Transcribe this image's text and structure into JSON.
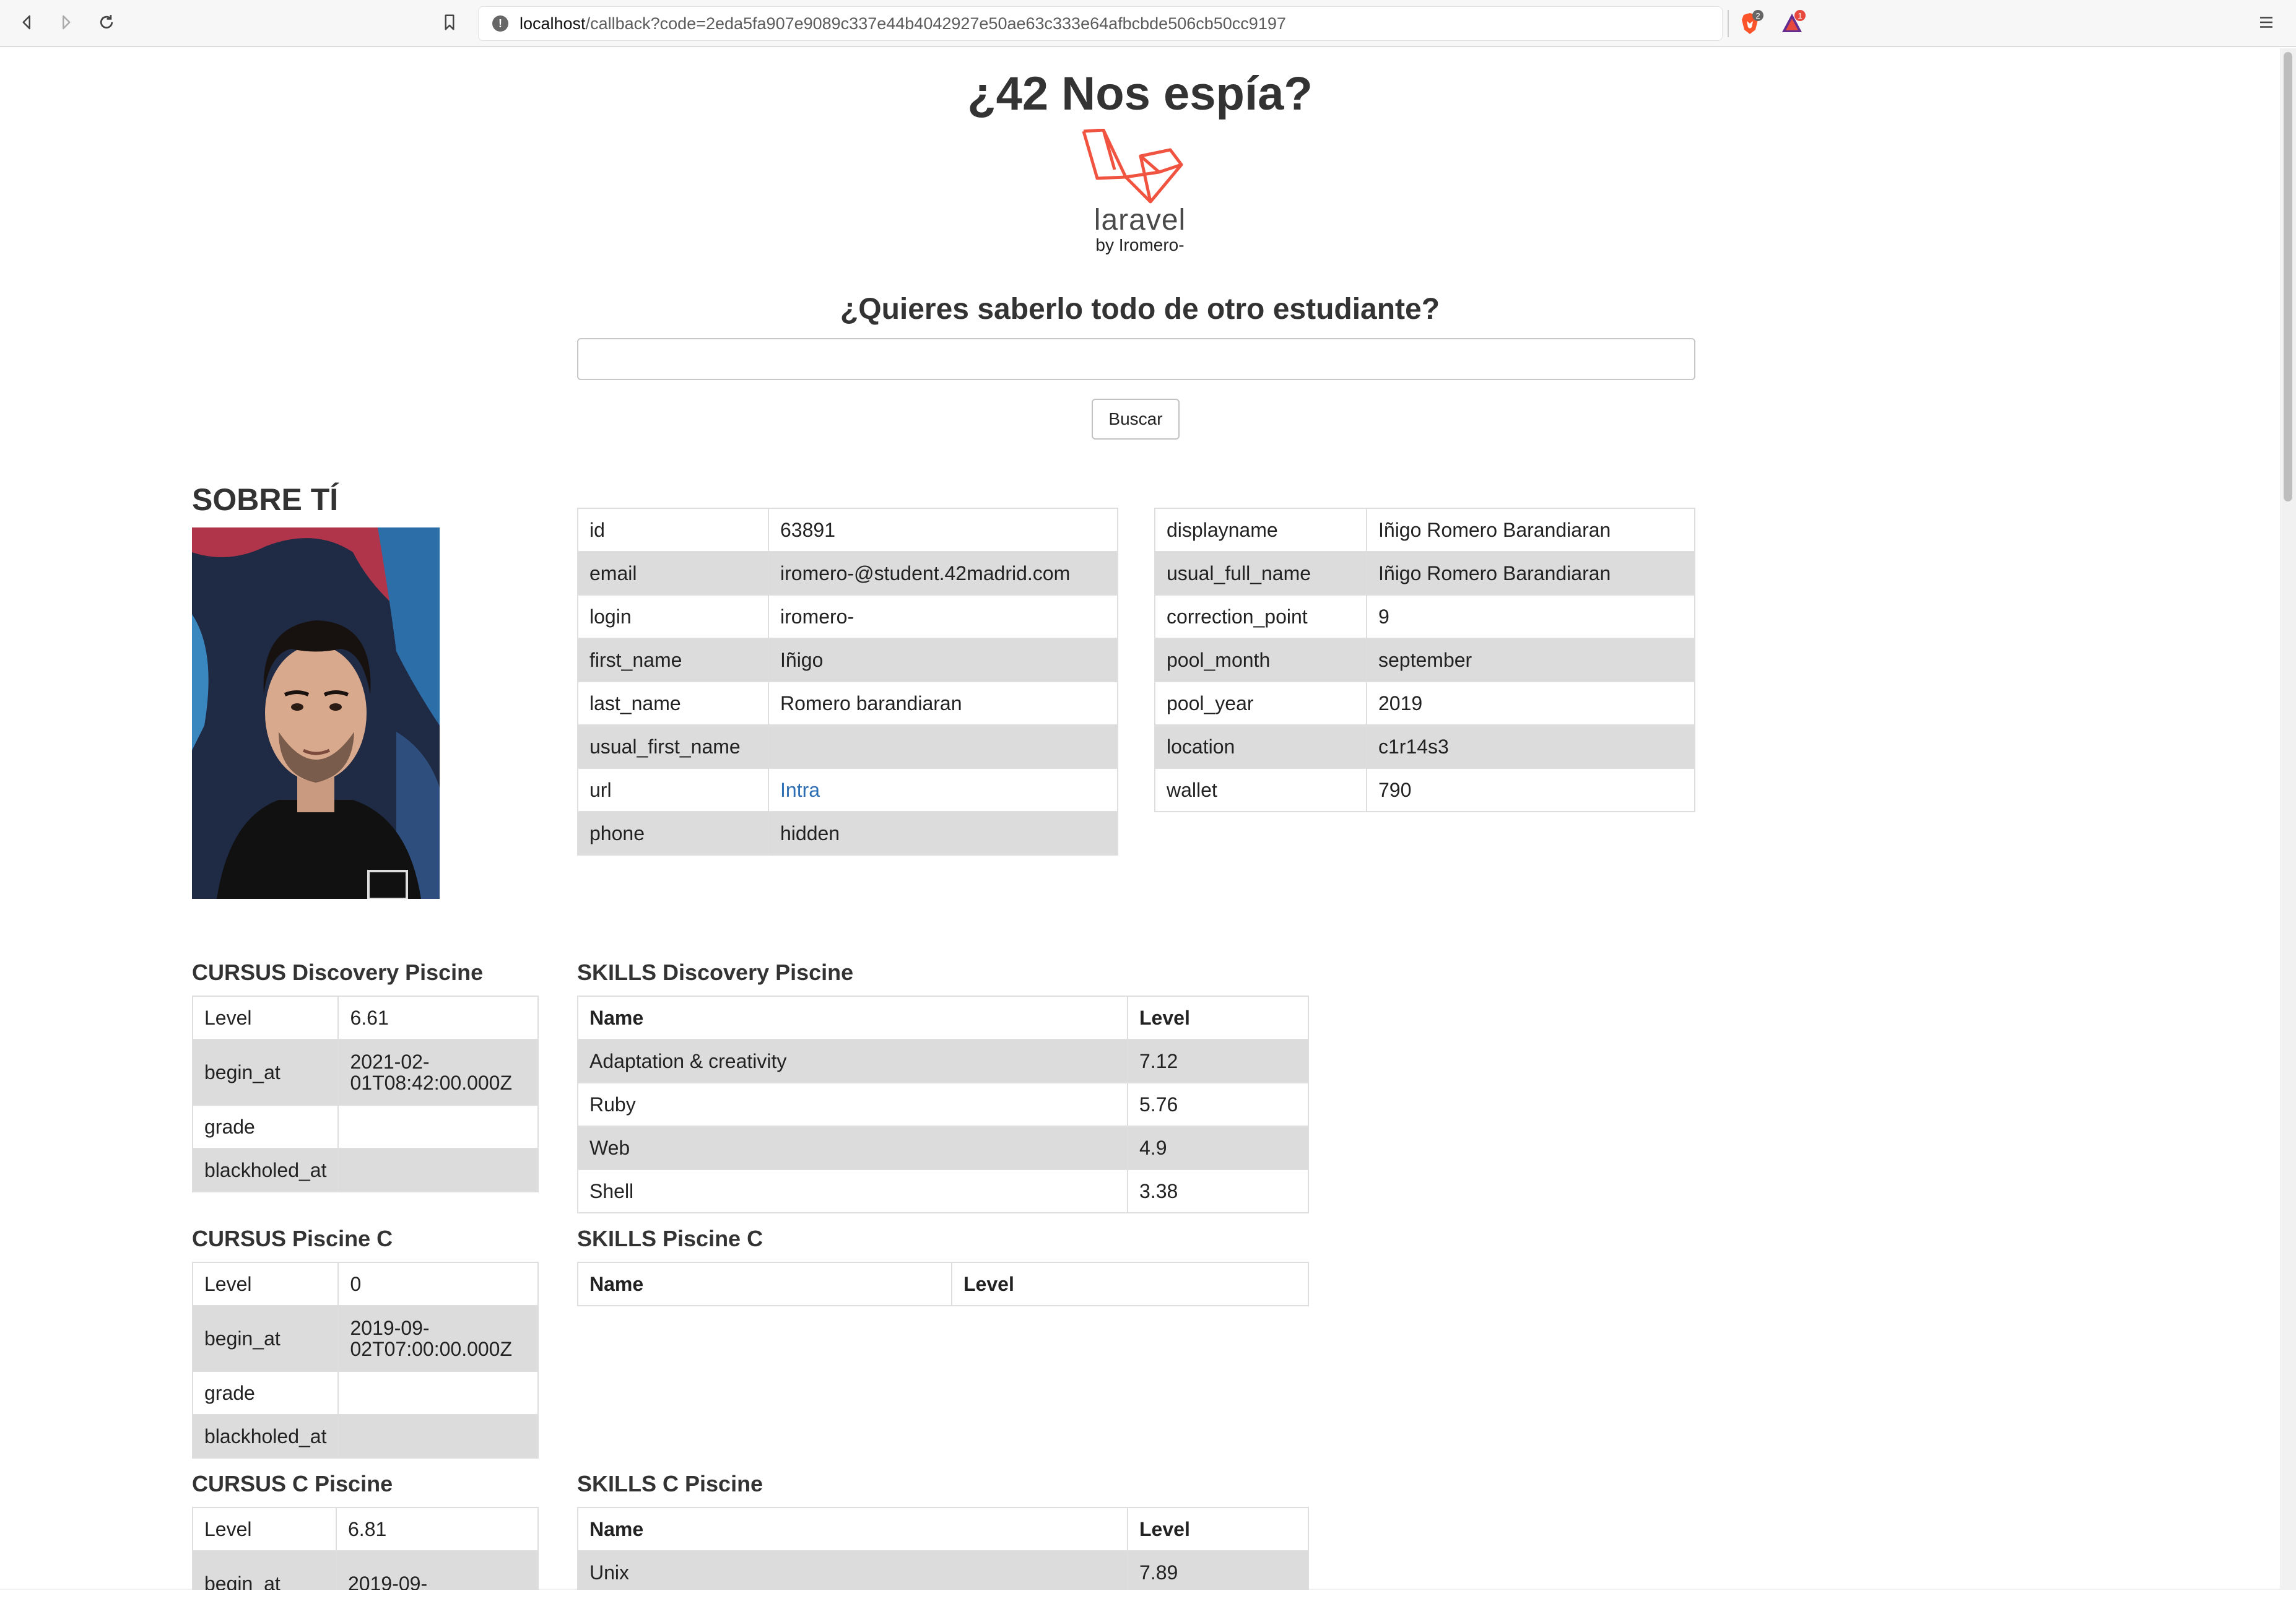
{
  "browser": {
    "url_host": "localhost",
    "url_rest": "/callback?code=2eda5fa907e9089c337e44b4042927e50ae63c333e64afbcbde506cb50cc9197",
    "brave_shield_count": "2",
    "rewards_count": "1"
  },
  "header": {
    "title": "¿42 Nos espía?",
    "logo_word": "laravel",
    "logo_by": "by Iromero-",
    "question": "¿Quieres saberlo todo de otro estudiante?",
    "search_value": "",
    "search_button": "Buscar"
  },
  "about": {
    "heading": "SOBRE TÍ",
    "left_table": [
      {
        "key": "id",
        "value": "63891"
      },
      {
        "key": "email",
        "value": "iromero-@student.42madrid.com"
      },
      {
        "key": "login",
        "value": "iromero-"
      },
      {
        "key": "first_name",
        "value": "Iñigo"
      },
      {
        "key": "last_name",
        "value": "Romero barandiaran"
      },
      {
        "key": "usual_first_name",
        "value": ""
      },
      {
        "key": "url",
        "value": "Intra"
      },
      {
        "key": "phone",
        "value": "hidden"
      }
    ],
    "right_table": [
      {
        "key": "displayname",
        "value": "Iñigo Romero Barandiaran"
      },
      {
        "key": "usual_full_name",
        "value": "Iñigo Romero Barandiaran"
      },
      {
        "key": "correction_point",
        "value": "9"
      },
      {
        "key": "pool_month",
        "value": "september"
      },
      {
        "key": "pool_year",
        "value": "2019"
      },
      {
        "key": "location",
        "value": "c1r14s3"
      },
      {
        "key": "wallet",
        "value": "790"
      }
    ]
  },
  "cursus": [
    {
      "title": "CURSUS Discovery Piscine",
      "rows": [
        {
          "key": "Level",
          "value": "6.61"
        },
        {
          "key": "begin_at",
          "value_l1": "2021-02-",
          "value_l2": "01T08:42:00.000Z"
        },
        {
          "key": "grade",
          "value": ""
        },
        {
          "key": "blackholed_at",
          "value": ""
        }
      ],
      "skills_title": "SKILLS Discovery Piscine",
      "skills_header": {
        "name": "Name",
        "level": "Level"
      },
      "skills": [
        {
          "name": "Adaptation & creativity",
          "level": "7.12"
        },
        {
          "name": "Ruby",
          "level": "5.76"
        },
        {
          "name": "Web",
          "level": "4.9"
        },
        {
          "name": "Shell",
          "level": "3.38"
        }
      ]
    },
    {
      "title": "CURSUS Piscine C",
      "rows": [
        {
          "key": "Level",
          "value": "0"
        },
        {
          "key": "begin_at",
          "value_l1": "2019-09-",
          "value_l2": "02T07:00:00.000Z"
        },
        {
          "key": "grade",
          "value": ""
        },
        {
          "key": "blackholed_at",
          "value": ""
        }
      ],
      "skills_title": "SKILLS Piscine C",
      "skills_header": {
        "name": "Name",
        "level": "Level"
      },
      "skills": []
    },
    {
      "title": "CURSUS C Piscine",
      "rows": [
        {
          "key": "Level",
          "value": "6.81"
        },
        {
          "key": "begin_at",
          "value_l1": "2019-09-",
          "value_l2": ""
        }
      ],
      "skills_title": "SKILLS C Piscine",
      "skills_header": {
        "name": "Name",
        "level": "Level"
      },
      "skills": [
        {
          "name": "Unix",
          "level": "7.89"
        }
      ]
    }
  ]
}
